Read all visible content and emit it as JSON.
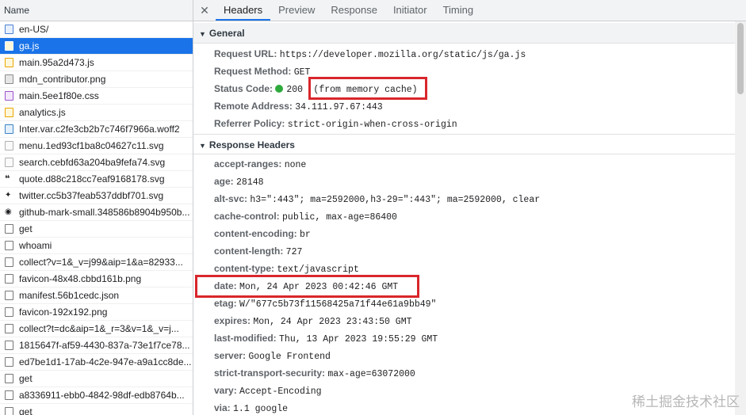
{
  "left": {
    "header": "Name",
    "requests": [
      {
        "name": "en-US/",
        "type": "doc"
      },
      {
        "name": "ga.js",
        "type": "js",
        "selected": true
      },
      {
        "name": "main.95a2d473.js",
        "type": "js"
      },
      {
        "name": "mdn_contributor.png",
        "type": "img"
      },
      {
        "name": "main.5ee1f80e.css",
        "type": "css"
      },
      {
        "name": "analytics.js",
        "type": "js"
      },
      {
        "name": "Inter.var.c2fe3cb2b7c746f7966a.woff2",
        "type": "font"
      },
      {
        "name": "menu.1ed93cf1ba8c04627c11.svg",
        "type": "svg"
      },
      {
        "name": "search.cebfd63a204ba9fefa74.svg",
        "type": "svg"
      },
      {
        "name": "quote.d88c218cc7eaf9168178.svg",
        "type": "quote"
      },
      {
        "name": "twitter.cc5b37feab537ddbf701.svg",
        "type": "tw"
      },
      {
        "name": "github-mark-small.348586b8904b950b...",
        "type": "gh"
      },
      {
        "name": "get",
        "type": "blank"
      },
      {
        "name": "whoami",
        "type": "blank"
      },
      {
        "name": "collect?v=1&_v=j99&aip=1&a=82933...",
        "type": "blank"
      },
      {
        "name": "favicon-48x48.cbbd161b.png",
        "type": "blank"
      },
      {
        "name": "manifest.56b1cedc.json",
        "type": "blank"
      },
      {
        "name": "favicon-192x192.png",
        "type": "blank"
      },
      {
        "name": "collect?t=dc&aip=1&_r=3&v=1&_v=j...",
        "type": "blank"
      },
      {
        "name": "1815647f-af59-4430-837a-73e1f7ce78...",
        "type": "blank"
      },
      {
        "name": "ed7be1d1-17ab-4c2e-947e-a9a1cc8de...",
        "type": "blank"
      },
      {
        "name": "get",
        "type": "blank"
      },
      {
        "name": "a8336911-ebb0-4842-98df-edb8764b...",
        "type": "blank"
      },
      {
        "name": "get",
        "type": "blank"
      }
    ]
  },
  "tabs": {
    "close": "✕",
    "items": [
      "Headers",
      "Preview",
      "Response",
      "Initiator",
      "Timing"
    ],
    "active": "Headers"
  },
  "general": {
    "title": "General",
    "rows": [
      {
        "key": "Request URL:",
        "value": "https://developer.mozilla.org/static/js/ga.js"
      },
      {
        "key": "Request Method:",
        "value": "GET"
      },
      {
        "key": "Status Code:",
        "value": "200",
        "extra": "(from memory cache)",
        "status_color": "#2eaa3c"
      },
      {
        "key": "Remote Address:",
        "value": "34.111.97.67:443"
      },
      {
        "key": "Referrer Policy:",
        "value": "strict-origin-when-cross-origin"
      }
    ]
  },
  "response": {
    "title": "Response Headers",
    "rows": [
      {
        "key": "accept-ranges:",
        "value": "none"
      },
      {
        "key": "age:",
        "value": "28148"
      },
      {
        "key": "alt-svc:",
        "value": "h3=\":443\"; ma=2592000,h3-29=\":443\"; ma=2592000, clear"
      },
      {
        "key": "cache-control:",
        "value": "public, max-age=86400"
      },
      {
        "key": "content-encoding:",
        "value": "br"
      },
      {
        "key": "content-length:",
        "value": "727"
      },
      {
        "key": "content-type:",
        "value": "text/javascript"
      },
      {
        "key": "date:",
        "value": "Mon, 24 Apr 2023 00:42:46 GMT"
      },
      {
        "key": "etag:",
        "value": "W/\"677c5b73f11568425a71f44e61a9bb49\""
      },
      {
        "key": "expires:",
        "value": "Mon, 24 Apr 2023 23:43:50 GMT"
      },
      {
        "key": "last-modified:",
        "value": "Thu, 13 Apr 2023 19:55:29 GMT"
      },
      {
        "key": "server:",
        "value": "Google Frontend"
      },
      {
        "key": "strict-transport-security:",
        "value": "max-age=63072000"
      },
      {
        "key": "vary:",
        "value": "Accept-Encoding"
      },
      {
        "key": "via:",
        "value": "1.1 google"
      }
    ]
  },
  "highlight_color": "#d9262c",
  "watermark": "稀土掘金技术社区"
}
